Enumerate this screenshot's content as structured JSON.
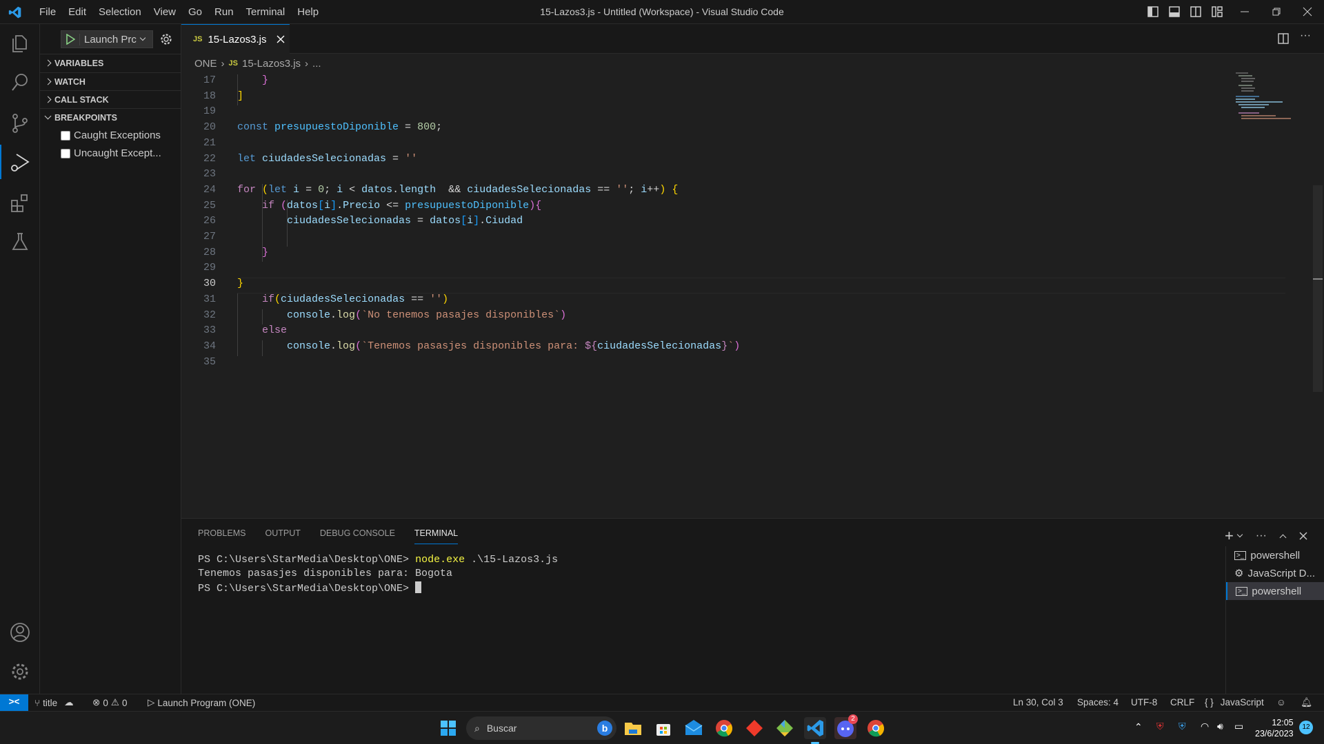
{
  "titlebar": {
    "menu": [
      "File",
      "Edit",
      "Selection",
      "View",
      "Go",
      "Run",
      "Terminal",
      "Help"
    ],
    "title": "15-Lazos3.js - Untitled (Workspace) - Visual Studio Code"
  },
  "sidebar": {
    "launch_config": "Launch Prc",
    "sections": [
      "VARIABLES",
      "WATCH",
      "CALL STACK",
      "BREAKPOINTS"
    ],
    "breakpoints": [
      {
        "label": "Caught Exceptions",
        "checked": false
      },
      {
        "label": "Uncaught Except...",
        "checked": false
      }
    ]
  },
  "editor": {
    "tab": {
      "icon": "JS",
      "label": "15-Lazos3.js"
    },
    "breadcrumb": [
      "ONE",
      "15-Lazos3.js",
      "..."
    ],
    "breadcrumb_icon": "JS",
    "current_line": 30,
    "lines": [
      {
        "n": "17",
        "t": [
          [
            "    ",
            "pl"
          ],
          [
            "}",
            "b2"
          ]
        ]
      },
      {
        "n": "18",
        "t": [
          [
            "]",
            "b1"
          ]
        ]
      },
      {
        "n": "19",
        "t": []
      },
      {
        "n": "20",
        "t": [
          [
            "const ",
            "kw"
          ],
          [
            "presupuestoDiponible",
            "cst"
          ],
          [
            " = ",
            "pl"
          ],
          [
            "800",
            "num"
          ],
          [
            ";",
            "pl"
          ]
        ]
      },
      {
        "n": "21",
        "t": []
      },
      {
        "n": "22",
        "t": [
          [
            "let ",
            "kw"
          ],
          [
            "ciudadesSelecionadas",
            "var"
          ],
          [
            " = ",
            "pl"
          ],
          [
            "''",
            "str"
          ]
        ]
      },
      {
        "n": "23",
        "t": []
      },
      {
        "n": "24",
        "t": [
          [
            "for ",
            "ctl"
          ],
          [
            "(",
            "b1"
          ],
          [
            "let ",
            "kw"
          ],
          [
            "i",
            "var"
          ],
          [
            " = ",
            "pl"
          ],
          [
            "0",
            "num"
          ],
          [
            "; ",
            "pl"
          ],
          [
            "i",
            "var"
          ],
          [
            " < ",
            "pl"
          ],
          [
            "datos",
            "var"
          ],
          [
            ".",
            "pl"
          ],
          [
            "length",
            "var"
          ],
          [
            "  && ",
            "pl"
          ],
          [
            "ciudadesSelecionadas",
            "var"
          ],
          [
            " == ",
            "pl"
          ],
          [
            "''",
            "str"
          ],
          [
            "; ",
            "pl"
          ],
          [
            "i",
            "var"
          ],
          [
            "++",
            "pl"
          ],
          [
            ")",
            "b1"
          ],
          [
            " ",
            "pl"
          ],
          [
            "{",
            "b1"
          ]
        ]
      },
      {
        "n": "25",
        "t": [
          [
            "    ",
            "pl"
          ],
          [
            "if ",
            "ctl"
          ],
          [
            "(",
            "b2"
          ],
          [
            "datos",
            "var"
          ],
          [
            "[",
            "b3"
          ],
          [
            "i",
            "var"
          ],
          [
            "]",
            "b3"
          ],
          [
            ".",
            "pl"
          ],
          [
            "Precio",
            "var"
          ],
          [
            " <= ",
            "pl"
          ],
          [
            "presupuestoDiponible",
            "cst"
          ],
          [
            ")",
            "b2"
          ],
          [
            "{",
            "b2"
          ]
        ]
      },
      {
        "n": "26",
        "t": [
          [
            "        ",
            "pl"
          ],
          [
            "ciudadesSelecionadas",
            "var"
          ],
          [
            " = ",
            "pl"
          ],
          [
            "datos",
            "var"
          ],
          [
            "[",
            "b3"
          ],
          [
            "i",
            "var"
          ],
          [
            "]",
            "b3"
          ],
          [
            ".",
            "pl"
          ],
          [
            "Ciudad",
            "var"
          ]
        ]
      },
      {
        "n": "27",
        "t": []
      },
      {
        "n": "28",
        "t": [
          [
            "    ",
            "pl"
          ],
          [
            "}",
            "b2"
          ]
        ]
      },
      {
        "n": "29",
        "t": []
      },
      {
        "n": "30",
        "t": [
          [
            "}",
            "b1"
          ]
        ]
      },
      {
        "n": "31",
        "t": [
          [
            "    ",
            "pl"
          ],
          [
            "if",
            "ctl"
          ],
          [
            "(",
            "b1"
          ],
          [
            "ciudadesSelecionadas",
            "var"
          ],
          [
            " == ",
            "pl"
          ],
          [
            "''",
            "str"
          ],
          [
            ")",
            "b1"
          ]
        ]
      },
      {
        "n": "32",
        "t": [
          [
            "        ",
            "pl"
          ],
          [
            "console",
            "var"
          ],
          [
            ".",
            "pl"
          ],
          [
            "log",
            "fn"
          ],
          [
            "(",
            "b2"
          ],
          [
            "`No tenemos pasajes disponibles`",
            "str"
          ],
          [
            ")",
            "b2"
          ]
        ]
      },
      {
        "n": "33",
        "t": [
          [
            "    ",
            "pl"
          ],
          [
            "else",
            "ctl"
          ]
        ]
      },
      {
        "n": "34",
        "t": [
          [
            "        ",
            "pl"
          ],
          [
            "console",
            "var"
          ],
          [
            ".",
            "pl"
          ],
          [
            "log",
            "fn"
          ],
          [
            "(",
            "b2"
          ],
          [
            "`Tenemos pasasjes disponibles para: ",
            "str"
          ],
          [
            "${",
            "ctl"
          ],
          [
            "ciudadesSelecionadas",
            "var"
          ],
          [
            "}",
            "ctl"
          ],
          [
            "`",
            "str"
          ],
          [
            ")",
            "b2"
          ]
        ]
      },
      {
        "n": "35",
        "t": []
      }
    ]
  },
  "panel": {
    "tabs": [
      "PROBLEMS",
      "OUTPUT",
      "DEBUG CONSOLE",
      "TERMINAL"
    ],
    "active_tab": "TERMINAL",
    "terminal": {
      "prompt": "PS C:\\Users\\StarMedia\\Desktop\\ONE> ",
      "command": "node.exe",
      "args": " .\\15-Lazos3.js",
      "output": "Tenemos pasasjes disponibles para: Bogota",
      "prompt2": "PS C:\\Users\\StarMedia\\Desktop\\ONE> "
    },
    "terminals": [
      "powershell",
      "JavaScript D...",
      "powershell"
    ]
  },
  "statusbar": {
    "branch": "title",
    "errors": "0",
    "warnings": "0",
    "launch": "Launch Program (ONE)",
    "position": "Ln 30, Col 3",
    "spaces": "Spaces: 4",
    "encoding": "UTF-8",
    "eol": "CRLF",
    "language": "JavaScript",
    "language_icon": "{ }"
  },
  "taskbar": {
    "search_placeholder": "Buscar",
    "discord_badge": "2",
    "time": "12:05",
    "date": "23/6/2023",
    "notifications": "12"
  },
  "colors": {
    "accent": "#0078d4",
    "editor_bg": "#1f1f1f",
    "chrome_bg": "#181818"
  }
}
